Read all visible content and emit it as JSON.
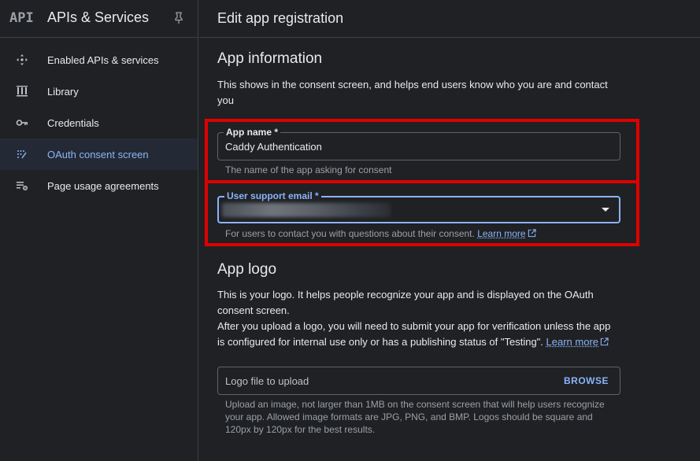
{
  "sidebar": {
    "logo": "API",
    "title": "APIs & Services",
    "items": [
      {
        "label": "Enabled APIs & services"
      },
      {
        "label": "Library"
      },
      {
        "label": "Credentials"
      },
      {
        "label": "OAuth consent screen",
        "active": true
      },
      {
        "label": "Page usage agreements"
      }
    ]
  },
  "main": {
    "header_title": "Edit app registration",
    "app_info": {
      "title": "App information",
      "description": "This shows in the consent screen, and helps end users know who you are and contact you",
      "app_name": {
        "label": "App name *",
        "value": "Caddy Authentication",
        "hint": "The name of the app asking for consent"
      },
      "support_email": {
        "label": "User support email *",
        "hint": "For users to contact you with questions about their consent.",
        "learn_more": "Learn more"
      }
    },
    "app_logo": {
      "title": "App logo",
      "description_1": "This is your logo. It helps people recognize your app and is displayed on the OAuth consent screen.",
      "description_2": "After you upload a logo, you will need to submit your app for verification unless the app is configured for internal use only or has a publishing status of \"Testing\".",
      "learn_more": "Learn more",
      "file_placeholder": "Logo file to upload",
      "browse_label": "BROWSE",
      "hint": "Upload an image, not larger than 1MB on the consent screen that will help users recognize your app. Allowed image formats are JPG, PNG, and BMP. Logos should be square and 120px by 120px for the best results."
    }
  },
  "colors": {
    "accent": "#8ab4f8",
    "highlight": "#e00000",
    "background": "#202124"
  }
}
